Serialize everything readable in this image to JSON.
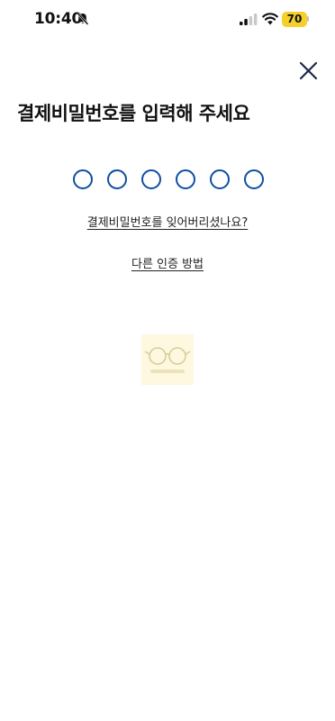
{
  "status_bar": {
    "time": "10:40",
    "battery": "70",
    "icons": [
      "bell-slash-icon",
      "cellular-signal-icon",
      "wifi-icon",
      "battery-icon"
    ]
  },
  "header": {
    "close_icon": "close-icon"
  },
  "title": "결제비밀번호를 입력해 주세요",
  "pin": {
    "length": 6,
    "filled": 0,
    "dot_color": "#0d4fa2"
  },
  "links": {
    "forgot": "결제비밀번호를 잊어버리셨나요?",
    "alt_auth": "다른 인증 방법"
  },
  "colors": {
    "accent": "#0d4fa2",
    "battery": "#f4d02a",
    "text": "#111111"
  }
}
